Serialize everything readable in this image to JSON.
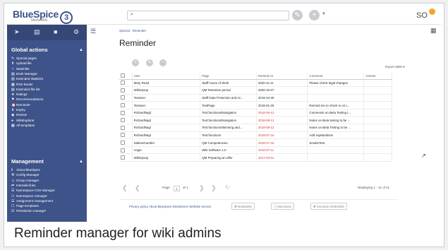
{
  "caption": "Reminder manager for wiki admins",
  "header": {
    "logo": "BlueSpice",
    "logo_num": "3",
    "logo_sub": "MediaWiki",
    "search_icon": "⌕",
    "user_initials": "SO"
  },
  "sidebar": {
    "tools": [
      "➤",
      "▤",
      "■",
      "⚙"
    ],
    "global_title": "Global actions",
    "global_items": [
      {
        "icon": "✎",
        "label": "Special pages"
      },
      {
        "icon": "⬆",
        "label": "Upload file"
      },
      {
        "icon": "☆",
        "label": "Watchlist"
      },
      {
        "icon": "▤",
        "label": "Book Manager"
      },
      {
        "icon": "▥",
        "label": "Extended statistics"
      },
      {
        "icon": "▦",
        "label": "RSS feeder"
      },
      {
        "icon": "▤",
        "label": "Extended file list"
      },
      {
        "icon": "★",
        "label": "Ratings"
      },
      {
        "icon": "⚑",
        "label": "Recommendations"
      },
      {
        "icon": "⏰",
        "label": "Reminder"
      },
      {
        "icon": "⬇",
        "label": "Expiry"
      },
      {
        "icon": "◉",
        "label": "Review"
      },
      {
        "icon": "●",
        "label": "WikiExplorer"
      },
      {
        "icon": "▦",
        "label": "All templates"
      }
    ],
    "management_title": "Management",
    "management_items": [
      {
        "icon": "ℹ",
        "label": "About BlueSpice"
      },
      {
        "icon": "⚒",
        "label": "Config Manager"
      },
      {
        "icon": "☺",
        "label": "Group manager"
      },
      {
        "icon": "⇄",
        "label": "Interwiki links"
      },
      {
        "icon": "☰",
        "label": "Namespace-CSS Manager"
      },
      {
        "icon": "☖",
        "label": "Namespace manager"
      },
      {
        "icon": "☰",
        "label": "Assignment management"
      },
      {
        "icon": "☐",
        "label": "Page templates"
      },
      {
        "icon": "☑",
        "label": "Permission manager"
      }
    ]
  },
  "main": {
    "breadcrumb": "Special · Reminder",
    "title": "Reminder",
    "export": "Export table",
    "columns": [
      "User",
      "Page",
      "Remind on",
      "Comment",
      "Actions"
    ],
    "rows": [
      {
        "user": "Mary Read",
        "page": "Staff Hours of Work",
        "date": "2020-11-11",
        "red": false,
        "comment": "Please check legal changes"
      },
      {
        "user": "WikiSysop",
        "page": "QM Retention period",
        "date": "2020-10-07",
        "red": false,
        "comment": ""
      },
      {
        "user": "Testuser",
        "page": "Staff Data Protection and Ac...",
        "date": "2019-10-30",
        "red": false,
        "comment": ""
      },
      {
        "user": "Testuser",
        "page": "TestPage",
        "date": "2019-01-29",
        "red": false,
        "comment": "Remind me to check in on t..."
      },
      {
        "user": "RichardNagl",
        "page": "Test:functions/Navigation",
        "date": "2018-08-12",
        "red": true,
        "comment": "Comments on Beta Testing t..."
      },
      {
        "user": "RichardNagl",
        "page": "Test:functions/Navigation",
        "date": "2018-08-12",
        "red": true,
        "comment": "Notes on Beta testing to be ..."
      },
      {
        "user": "RichardNagl",
        "page": "Test:functions/Skinning and...",
        "date": "2018-08-12",
        "red": true,
        "comment": "Notes on Beta Testing to be ..."
      },
      {
        "user": "RichardNagl",
        "page": "Test:functions",
        "date": "2018-07-16",
        "red": true,
        "comment": "Add explanations"
      },
      {
        "user": "SabineGuertler",
        "page": "QM Competencies",
        "date": "2018-07-16",
        "red": true,
        "comment": "SmokeTest"
      },
      {
        "user": "Angie",
        "page": "Wiki Software 1.0",
        "date": "2018-07-11",
        "red": true,
        "comment": ""
      },
      {
        "user": "WikiSysop",
        "page": "QM Preparing an offer",
        "date": "2017-03-01",
        "red": true,
        "comment": ""
      }
    ],
    "pager": {
      "page_label": "Page",
      "page_value": "1",
      "of_label": "of 1",
      "displaying": "Displaying 1 - 11 of 11"
    }
  },
  "footer": {
    "links": "Privacy policy   About BlueSpice   Disclaimers   Website service",
    "badges": [
      "MediaWiki",
      "BlueSpice",
      "Semantic MediaWiki"
    ]
  }
}
